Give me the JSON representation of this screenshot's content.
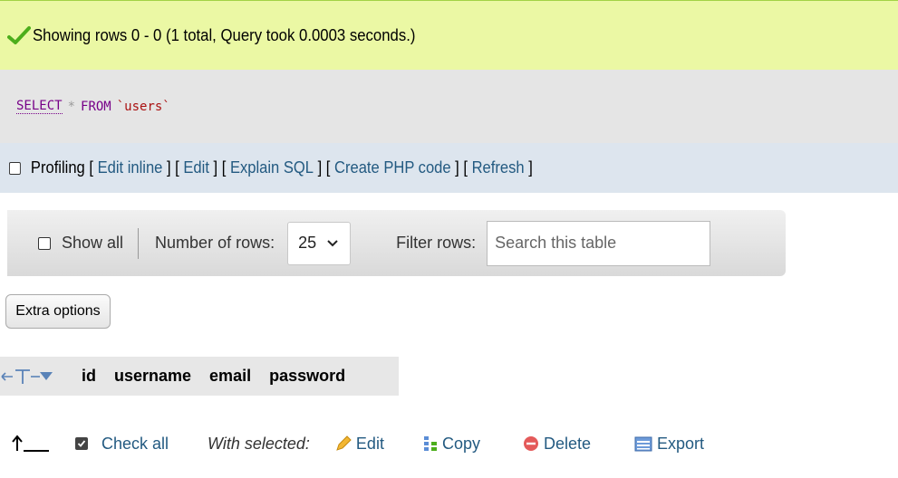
{
  "message": {
    "text": "Showing rows 0 - 0 (1 total, Query took 0.0003 seconds.)",
    "icon": "checkmark-icon"
  },
  "sql": {
    "select": "SELECT",
    "star": "*",
    "from": "FROM",
    "table": "`users`"
  },
  "profiling": {
    "label": "Profiling",
    "links": [
      "Edit inline",
      "Edit",
      "Explain SQL",
      "Create PHP code",
      "Refresh"
    ]
  },
  "navigation": {
    "show_all": "Show all",
    "rows_label": "Number of rows:",
    "rows_value": "25",
    "filter_label": "Filter rows:",
    "search_placeholder": "Search this table"
  },
  "extra_options": "Extra options",
  "table": {
    "columns": [
      "id",
      "username",
      "email",
      "password"
    ]
  },
  "bulk": {
    "check_all": "Check all",
    "with_selected": "With selected:",
    "edit": "Edit",
    "copy": "Copy",
    "delete": "Delete",
    "export": "Export"
  },
  "colors": {
    "success_bg": "#ebf8a4",
    "sql_bg": "#e5e5e5",
    "profiling_bg": "#dde5ee",
    "link": "#235a81",
    "keyword": "#770088",
    "table_name": "#aa1111"
  }
}
